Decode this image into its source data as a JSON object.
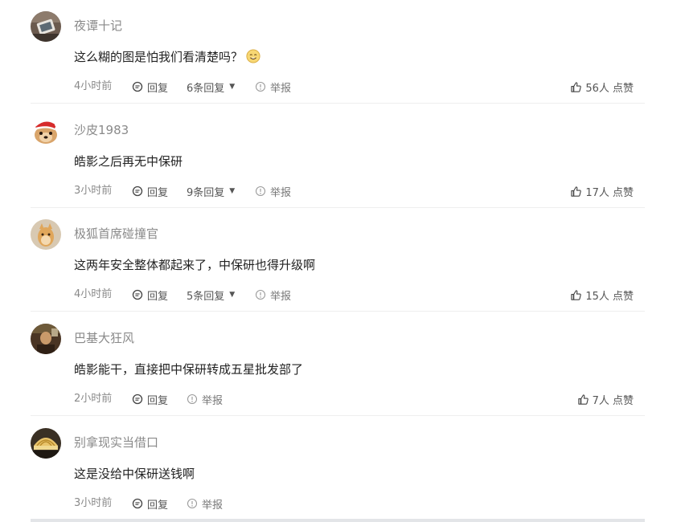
{
  "comments": [
    {
      "username": "夜谭十记",
      "content": "这么糊的图是怕我们看清楚吗？",
      "emoji": "smile-emoji",
      "time": "4小时前",
      "reply_label": "回复",
      "replies_count": "6条回复",
      "report_label": "举报",
      "likes": "56人 点赞"
    },
    {
      "username": "沙皮1983",
      "content": "皓影之后再无中保研",
      "time": "3小时前",
      "reply_label": "回复",
      "replies_count": "9条回复",
      "report_label": "举报",
      "likes": "17人 点赞"
    },
    {
      "username": "极狐首席碰撞官",
      "content": "这两年安全整体都起来了，中保研也得升级啊",
      "time": "4小时前",
      "reply_label": "回复",
      "replies_count": "5条回复",
      "report_label": "举报",
      "likes": "15人 点赞"
    },
    {
      "username": "巴基大狂风",
      "content": "皓影能干，直接把中保研转成五星批发部了",
      "time": "2小时前",
      "reply_label": "回复",
      "report_label": "举报",
      "likes": "7人 点赞"
    },
    {
      "username": "别拿现实当借口",
      "content": "这是没给中保研送钱啊",
      "time": "3小时前",
      "reply_label": "回复",
      "report_label": "举报"
    }
  ],
  "icons": {
    "reply": "comment-bubble-icon",
    "report": "info-circle-icon",
    "like": "thumbs-up-icon",
    "caret": "caret-down-icon"
  },
  "colors": {
    "meta_text": "#8a8a8a",
    "content_text": "#222222",
    "divider": "#eeeeee"
  }
}
